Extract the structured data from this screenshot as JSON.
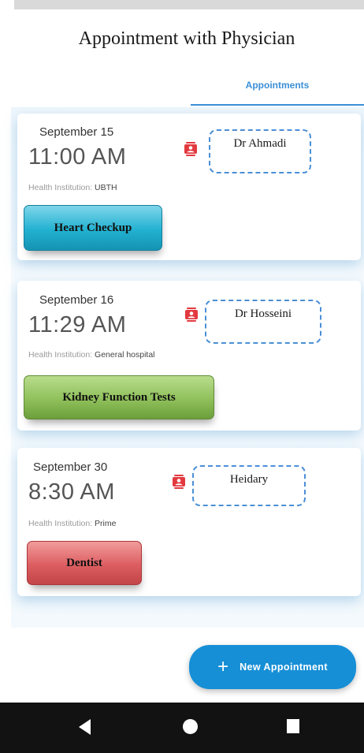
{
  "header": {
    "title": "Appointment with Physician"
  },
  "tabs": [
    {
      "label": "Appointments",
      "selected": true
    }
  ],
  "appointments": [
    {
      "date": "September 15",
      "time": "11:00 AM",
      "institution_label": "Health Institution: ",
      "institution": "UBTH",
      "doctor": "Dr Ahmadi",
      "service": "Heart Checkup",
      "service_color": "#22b1d1"
    },
    {
      "date": "September 16",
      "time": "11:29 AM",
      "institution_label": "Health Institution: ",
      "institution": "General hospital",
      "doctor": "Dr Hosseini",
      "service": "Kidney Function Tests",
      "service_color": "#8fc05a"
    },
    {
      "date": "September 30",
      "time": "8:30 AM",
      "institution_label": "Health Institution: ",
      "institution": "Prime",
      "doctor": "Heidary",
      "service": "Dentist",
      "service_color": "#dc5e61"
    }
  ],
  "fab": {
    "icon": "plus-icon",
    "label": "New Appointment"
  },
  "nav": {
    "back": "back-icon",
    "home": "home-icon",
    "recents": "recents-icon"
  },
  "colors": {
    "accent": "#3b8fd6",
    "fab": "#168fd6",
    "contact_icon": "#e2393f",
    "nav_bar": "#121212"
  }
}
